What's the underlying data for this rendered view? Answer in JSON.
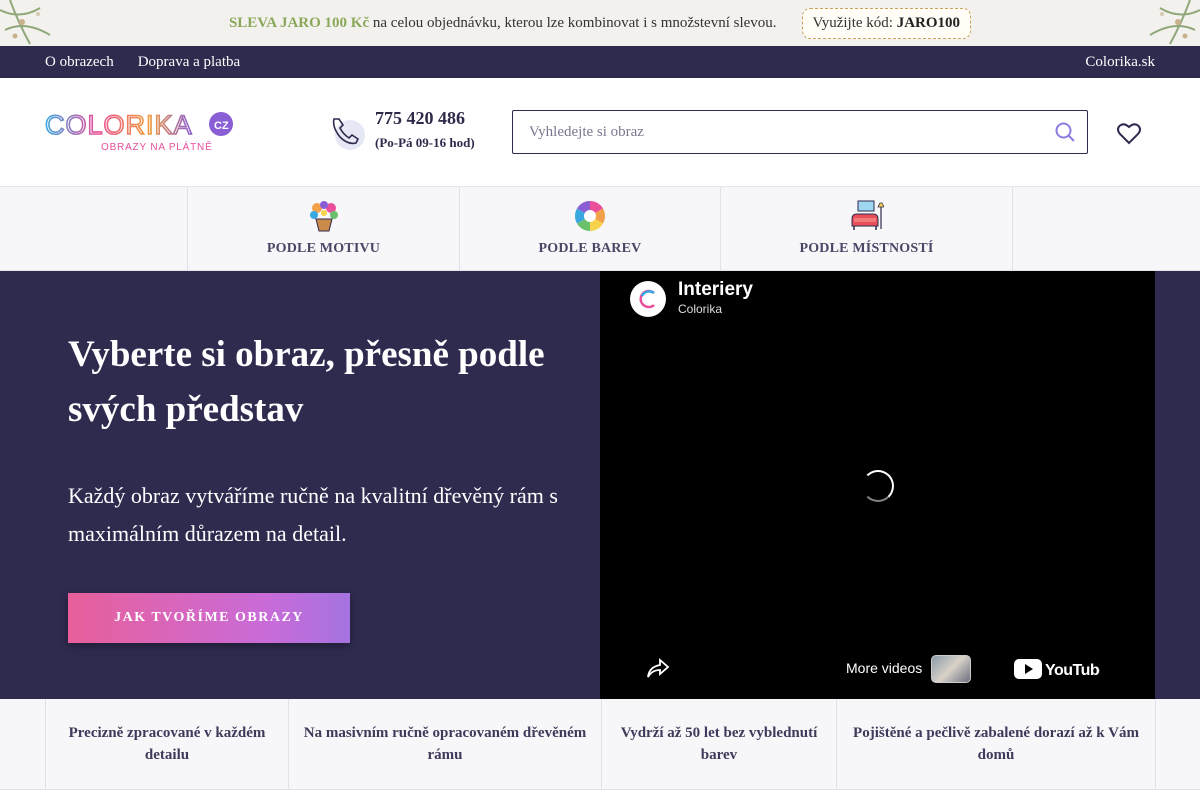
{
  "promo": {
    "highlight": "SLEVA JARO 100 Kč",
    "text": " na celou objednávku, kterou lze kombinovat i s množstevní slevou.",
    "code_prefix": " Využijte kód: ",
    "code": "JARO100"
  },
  "topnav": {
    "items": [
      "O obrazech",
      "Doprava a platba"
    ],
    "right_link": "Colorika.sk"
  },
  "header": {
    "phone": "775 420 486",
    "hours": "(Po-Pá 09-16 hod)",
    "search_placeholder": "Vyhledejte si obraz",
    "colors": {
      "navy": "#2e2b4f",
      "pink": "#e85f9a",
      "purple": "#a473e0"
    }
  },
  "categories": [
    {
      "label": "PODLE MOTIVU",
      "icon": "flower-bouquet-icon"
    },
    {
      "label": "PODLE BAREV",
      "icon": "color-wheel-icon"
    },
    {
      "label": "PODLE MÍSTNOSTÍ",
      "icon": "room-sofa-icon"
    }
  ],
  "hero": {
    "title": "Vyberte si obraz, přesně podle svých představ",
    "subtitle": "Každý obraz vytváříme ručně na kvalitní dřevěný rám s maximálním důrazem na detail.",
    "button": "JAK TVOŘÍME OBRAZY"
  },
  "video": {
    "title": "Interiery",
    "author": "Colorika",
    "more_videos": "More videos"
  },
  "features": [
    "Precizně zpracované v každém detailu",
    "Na masivním ručně opracovaném dřevěném rámu",
    "Vydrží až 50 let bez vyblednutí barev",
    "Pojištěné a pečlivě zabalené dorazí až k Vám domů"
  ]
}
